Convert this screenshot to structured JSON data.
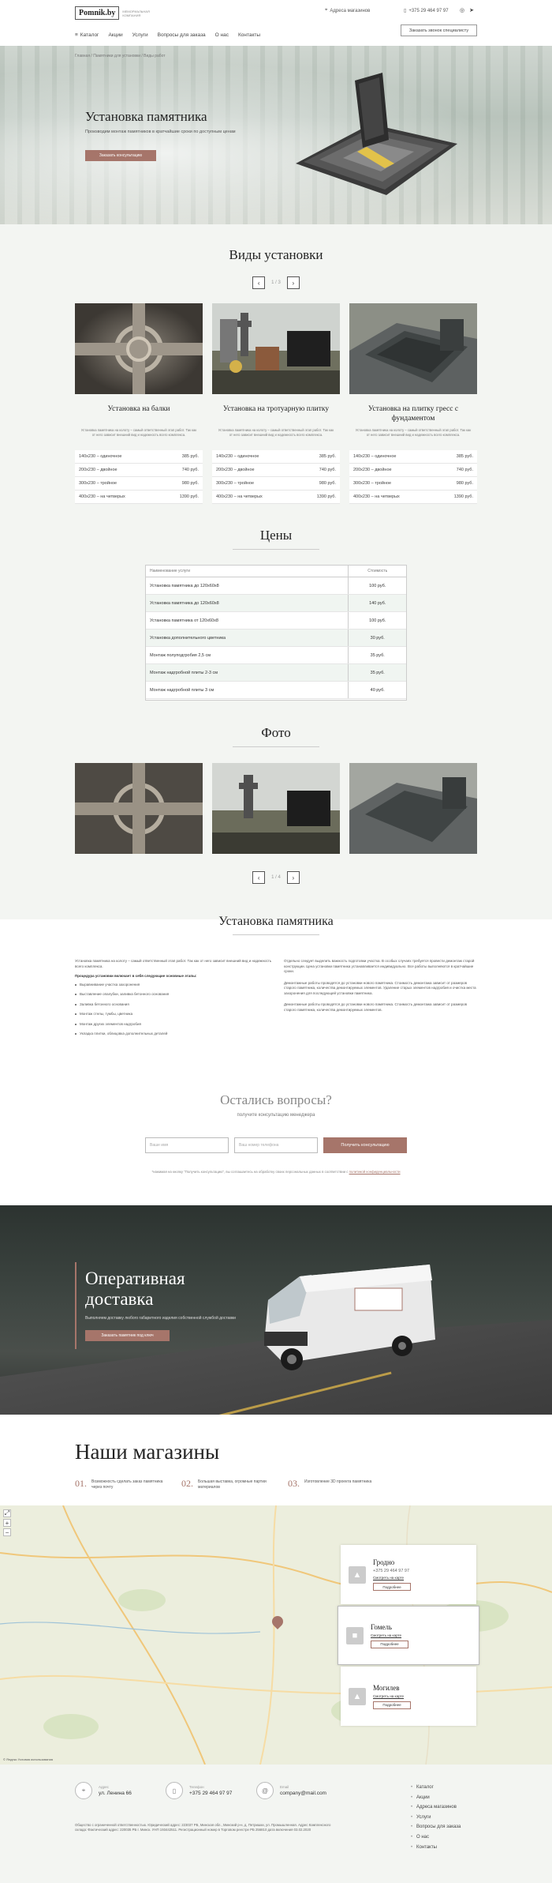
{
  "header": {
    "logo_text": "Pomnik.by",
    "logo_sub": "МЕМОРИАЛЬНАЯ КОМПАНИЯ",
    "address_label": "Адреса магазинов",
    "phone": "+375 29 464 97 97",
    "callback_button": "Заказать звонок специалисту",
    "nav": [
      "Каталог",
      "Акции",
      "Услуги",
      "Вопросы для заказа",
      "О нас",
      "Контакты"
    ]
  },
  "hero": {
    "breadcrumb": "Главная  /  Памятники для установки / Виды работ",
    "title": "Установка памятника",
    "subtitle": "Производим монтаж памятников в кратчайшие сроки по доступным ценам",
    "button": "Заказать консультацию"
  },
  "types": {
    "title": "Виды установки",
    "pager": "1 / 3",
    "cards": [
      {
        "title": "Установка на балки",
        "desc": "Установка памятника на колоту – самый ответственный этап работ. Так как от него зависит внешний вид и надежность всего комплекса.",
        "prices": [
          {
            "size": "140х230 – одиночное",
            "price": "385 руб."
          },
          {
            "size": "200х230 – двойное",
            "price": "740 руб."
          },
          {
            "size": "300х230 – тройное",
            "price": "980 руб."
          },
          {
            "size": "400х230 – на четверых",
            "price": "1390 руб."
          }
        ]
      },
      {
        "title": "Установка на тротуарную плитку",
        "desc": "Установка памятника на колоту – самый ответственный этап работ. Так как от него зависит внешний вид и надежность всего комплекса.",
        "prices": [
          {
            "size": "140х230 – одиночное",
            "price": "385 руб."
          },
          {
            "size": "200х230 – двойное",
            "price": "740 руб."
          },
          {
            "size": "300х230 – тройное",
            "price": "980 руб."
          },
          {
            "size": "400х230 – на четверых",
            "price": "1390 руб."
          }
        ]
      },
      {
        "title": "Установка на плитку гресс с фундаментом",
        "desc": "Установка памятника на колоту – самый ответственный этап работ. Так как от него зависит внешний вид и надежность всего комплекса.",
        "prices": [
          {
            "size": "140х230 – одиночное",
            "price": "385 руб."
          },
          {
            "size": "200х230 – двойное",
            "price": "740 руб."
          },
          {
            "size": "300х230 – тройное",
            "price": "980 руб."
          },
          {
            "size": "400х230 – на четверых",
            "price": "1390 руб."
          }
        ]
      }
    ]
  },
  "prices": {
    "title": "Цены",
    "col_service": "Наименование услуги",
    "col_cost": "Стоимость",
    "rows": [
      {
        "name": "Установка памятника до 120х60х8",
        "cost": "100 руб."
      },
      {
        "name": "Установка памятника до 120х60х8",
        "cost": "140 руб."
      },
      {
        "name": "Установка памятника от 120х60х8",
        "cost": "100 руб."
      },
      {
        "name": "Установка дополнительного цветника",
        "cost": "30 руб."
      },
      {
        "name": "Монтаж полуподгробия 2,5 см",
        "cost": "35 руб."
      },
      {
        "name": "Монтаж надгробной плиты 2-3 см",
        "cost": "35 руб."
      },
      {
        "name": "Монтаж надгробной плиты 3 см",
        "cost": "40 руб."
      }
    ]
  },
  "photos": {
    "title": "Фото",
    "pager": "1 / 4"
  },
  "about": {
    "title": "Установка памятника",
    "intro": "Установка памятника на колоту – самый ответственный этап работ. Так как от него зависит внешний вид и надежность всего комплекса.",
    "steps_title": "Процедура установки включает в себя следующие основные этапы:",
    "steps": [
      "Выравнивание участка захоронения",
      "Выставление опалубки, заливка бетонного основания",
      "Заливка бетонного основания",
      "Монтаж стелы, тумбы, цветника",
      "Монтаж других элементов надгробия",
      "Укладка плитки, облицовка дополнительных деталей"
    ],
    "right_p1": "Отдельно следует выделить важность подготовки участка. В особых случаях требуется провести демонтаж старой конструкции. Цена установки памятника устанавливается индивидуально. Все работы выполняются в кратчайшие сроки.",
    "right_p2": "Демонтажные работы проводятся до установки нового памятника. Стоимость демонтажа зависит от размеров старого памятника, количества демонтируемых элементов. Удаление старых элементов надгробия и очистка места захоронения для последующей установки памятника.",
    "right_p3": "Демонтажные работы проводятся до установки нового памятника. Стоимость демонтажа зависит от размеров старого памятника, количества демонтируемых элементов."
  },
  "questions": {
    "title": "Остались вопросы?",
    "subtitle": "получите консультацию менеджера",
    "name_placeholder": "Ваше имя",
    "phone_placeholder": "Ваш номер телефона",
    "button": "Получить консультацию",
    "note": "*нажимая на кнопку \"Получить консультацию\", вы соглашаетесь на обработку своих персональных данных в соответствии с",
    "note_link": "политикой конфиденциальности"
  },
  "delivery": {
    "title": "Оперативная доставка",
    "subtitle": "Выполняем доставку любого габаритного изделия собственной службой доставки",
    "button": "Заказать памятник под ключ"
  },
  "shops": {
    "title": "Наши магазины",
    "features": [
      {
        "num": "01.",
        "text": "Возможность сделать заказ памятника через почту"
      },
      {
        "num": "02.",
        "text": "Большая выставка, огромные партии материалов"
      },
      {
        "num": "03.",
        "text": "Изготовление 3D проекта памятника"
      }
    ],
    "cards": [
      {
        "city": "Гродно",
        "phone": "+375 29 464 97 97",
        "link": "Смотреть на карте",
        "more": "Подробнее"
      },
      {
        "city": "Гомель",
        "phone": "+375 29 464 97 97",
        "link": "Смотреть на карте",
        "more": "Подробнее"
      },
      {
        "city": "Могилев",
        "phone": "+375 29 464 97 97",
        "link": "Смотреть на карте",
        "more": "Подробнее"
      }
    ],
    "map_credit": "© Яндекс  Условия использования"
  },
  "footer": {
    "contacts": [
      {
        "label": "Адрес",
        "value": "ул. Ленина 66",
        "icon": "location-icon"
      },
      {
        "label": "Телефон",
        "value": "+375 29 464 97 97",
        "icon": "phone-icon"
      },
      {
        "label": "Email",
        "value": "company@mail.com",
        "icon": "email-icon"
      }
    ],
    "legal": "Общество с ограниченной ответственностью. Юридический адрес: 223037 РБ, Минская обл., Минский р-н, д. Петришки, ул. Промышленная. Адрес Комплексного склада: Фактический адрес: 220035 РБ г. Минск. УНП 193442511. Регистрационный номер в Торговом реестре РБ 256810 дата включения 03.02.2020",
    "menu": [
      "Каталог",
      "Акции",
      "Адреса магазинов",
      "Услуги",
      "Вопросы для заказа",
      "О нас",
      "Контакты"
    ]
  }
}
